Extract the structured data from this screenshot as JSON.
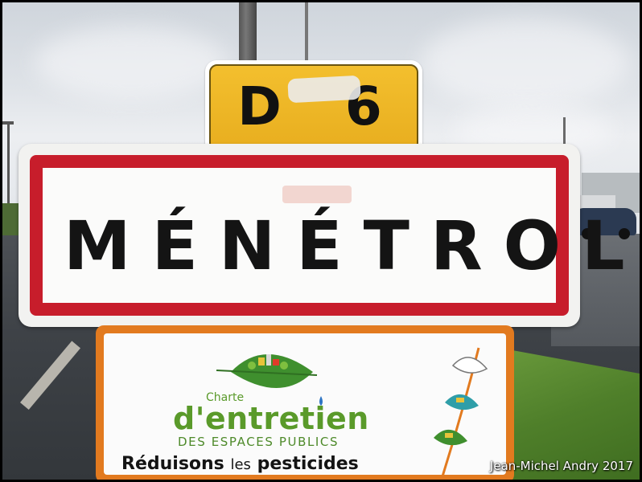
{
  "photo": {
    "route_sign": {
      "text": "D 6",
      "color": "#f0b828"
    },
    "town_sign": {
      "name": "MÉNÉTROL",
      "border_color": "#c71d2b"
    },
    "charte_panel": {
      "small_title": "Charte",
      "main_title": "d'entretien",
      "subtitle": "DES ESPACES PUBLICS",
      "slogan_part1": "Réduisons",
      "slogan_part2": "les",
      "slogan_part3": "pesticides",
      "frame_color": "#e27a1f",
      "text_color": "#5a9a2a"
    },
    "credit": "Jean-Michel Andry 2017"
  }
}
